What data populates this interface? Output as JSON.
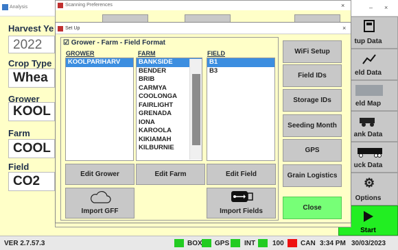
{
  "app": {
    "title": "Analysis",
    "version": "VER 2.7.57.3",
    "fields": {
      "harvest_year_label": "Harvest Ye",
      "harvest_year_value": "2022",
      "crop_type_label": "Crop Type",
      "crop_type_value": "Whea",
      "grower_label": "Grower",
      "grower_value": "KOOL",
      "farm_label": "Farm",
      "farm_value": "COOL",
      "field_label": "Field",
      "field_value": "CO2"
    },
    "right_buttons": [
      "tup Data",
      "eld Data",
      "eld Map",
      "ank Data",
      "uck Data",
      "Options"
    ],
    "start_label": "Start",
    "colors": {
      "start": "#22ee22",
      "led_green": "#22cc22",
      "led_red": "#ee1111"
    }
  },
  "statusbar": {
    "box": "BOX",
    "gps": "GPS",
    "int": "INT",
    "num": "100",
    "can": "CAN",
    "time": "3:34 PM",
    "date": "30/03/2023"
  },
  "scan_dialog": {
    "title": "Scanning Preferences"
  },
  "setup": {
    "title": "Set Up",
    "gff_format_label": "Grower - Farm - Field  Format",
    "grower_header": "GROWER",
    "farm_header": "FARM",
    "field_header": "FIELD",
    "growers": [
      "KOOLPARIHARV"
    ],
    "farms": [
      "BANKSIDE",
      "BENDER",
      "BRIB",
      "CARMYA",
      "COOLONGA",
      "FAIRLIGHT",
      "GRENADA",
      "IONA",
      "KAROOLA",
      "KIKIAMAH",
      "KILBURNIE"
    ],
    "fields": [
      "B1",
      "B3"
    ],
    "edit_grower": "Edit Grower",
    "edit_farm": "Edit Farm",
    "edit_field": "Edit Field",
    "import_gff": "Import GFF",
    "import_fields": "Import Fields",
    "side_buttons": [
      "WiFi Setup",
      "Field IDs",
      "Storage IDs",
      "Seeding Month",
      "GPS",
      "Grain Logistics"
    ],
    "close": "Close"
  }
}
